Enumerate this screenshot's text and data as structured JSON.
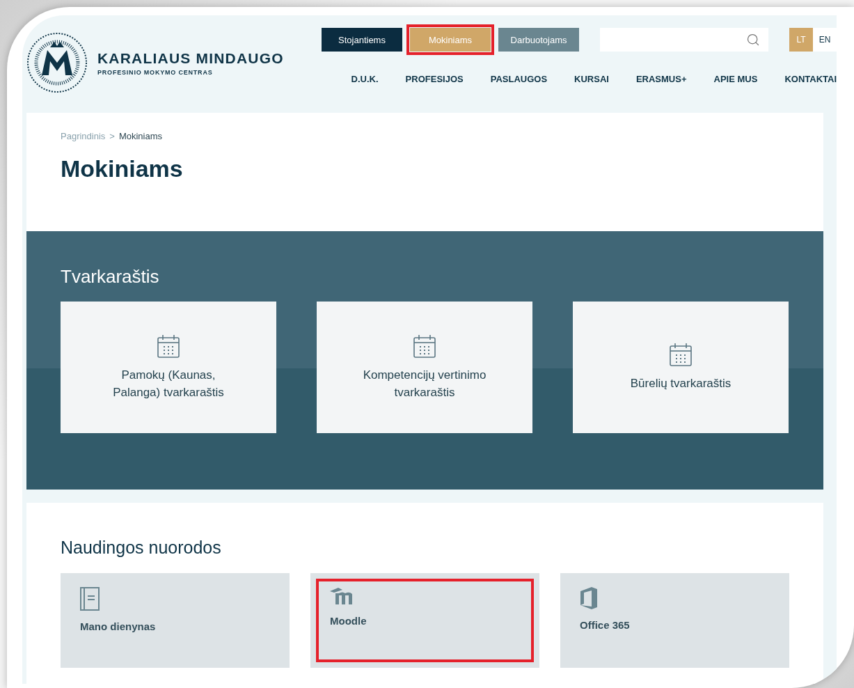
{
  "logo": {
    "title": "KARALIAUS MINDAUGO",
    "subtitle": "PROFESINIO MOKYMO CENTRAS"
  },
  "audience_tabs": [
    {
      "label": "Stojantiems",
      "kind": "dark",
      "highlighted": false
    },
    {
      "label": "Mokiniams",
      "kind": "gold",
      "highlighted": true
    },
    {
      "label": "Darbuotojams",
      "kind": "grey",
      "highlighted": false
    }
  ],
  "languages": [
    {
      "label": "LT",
      "selected": true
    },
    {
      "label": "EN",
      "selected": false
    }
  ],
  "nav": [
    "D.U.K.",
    "PROFESIJOS",
    "PASLAUGOS",
    "KURSAI",
    "ERASMUS+",
    "APIE MUS",
    "KONTAKTAI"
  ],
  "breadcrumb": [
    "Pagrindinis",
    "Mokiniams"
  ],
  "breadcrumb_separator": ">",
  "page_title": "Mokiniams",
  "schedule": {
    "title": "Tvarkaraštis",
    "cards": [
      "Pamokų (Kaunas,\nPalanga) tvarkaraštis",
      "Kompetencijų vertinimo\ntvarkaraštis",
      "Būrelių tvarkaraštis"
    ]
  },
  "links": {
    "title": "Naudingos nuorodos",
    "tiles": [
      {
        "label": "Mano dienynas",
        "kind": "diary",
        "highlighted": false
      },
      {
        "label": "Moodle",
        "kind": "moodle",
        "highlighted": true
      },
      {
        "label": "Office 365",
        "kind": "office",
        "highlighted": false
      }
    ]
  }
}
